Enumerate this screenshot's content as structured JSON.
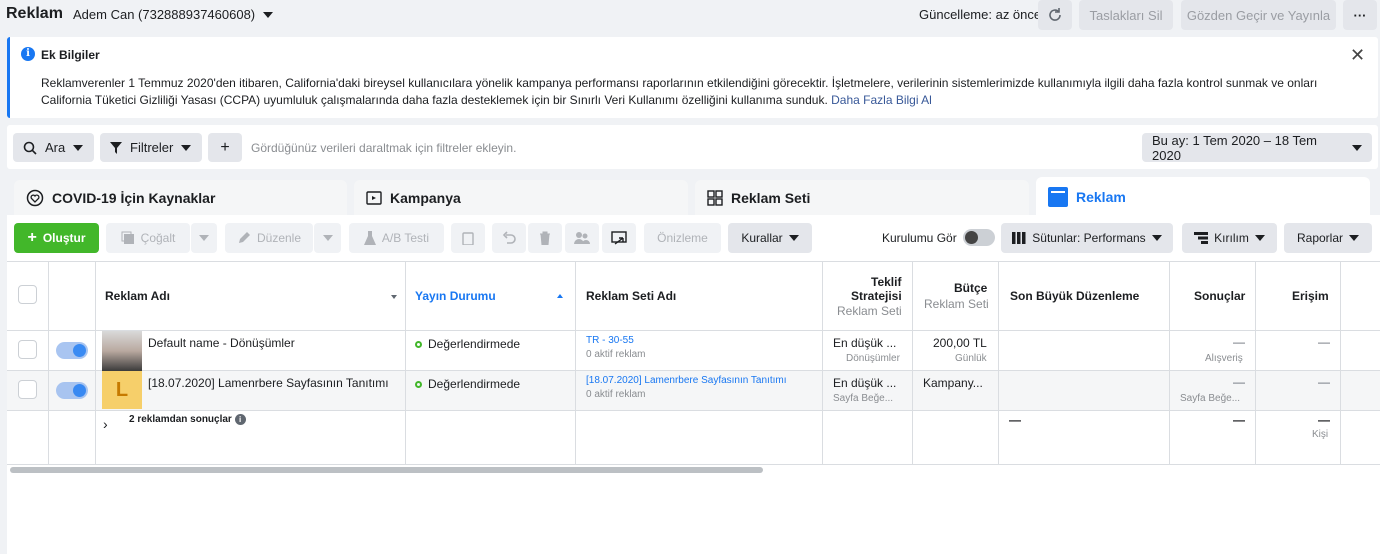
{
  "topbar": {
    "title": "Reklam",
    "account": "Adem Can (732888937460608)",
    "update_status": "Güncelleme: az önce",
    "delete_drafts": "Taslakları Sil",
    "review_publish": "Gözden Geçir ve Yayınla",
    "more": "···"
  },
  "banner": {
    "title": "Ek Bilgiler",
    "text": "Reklamverenler 1 Temmuz 2020'den itibaren, California'daki bireysel kullanıcılara yönelik kampanya performansı raporlarının etkilendiğini görecektir. İşletmelere, verilerinin sistemlerimizde kullanımıyla ilgili daha fazla kontrol sunmak ve onları California Tüketici Gizliliği Yasası (CCPA) uyumluluk çalışmalarında daha fazla desteklemek için bir Sınırlı Veri Kullanımı özelliğini kullanıma sunduk.",
    "link": "Daha Fazla Bilgi Al"
  },
  "filters": {
    "search": "Ara",
    "filters": "Filtreler",
    "add": "+",
    "hint": "Gördüğünüz verileri daraltmak için filtreler ekleyin.",
    "date_range": "Bu ay: 1 Tem 2020 – 18 Tem 2020"
  },
  "tabs": [
    {
      "label": "COVID-19 İçin Kaynaklar"
    },
    {
      "label": "Kampanya"
    },
    {
      "label": "Reklam Seti"
    },
    {
      "label": "Reklam"
    }
  ],
  "toolbar": {
    "create": "Oluştur",
    "duplicate": "Çoğalt",
    "edit": "Düzenle",
    "ab_test": "A/B Testi",
    "preview": "Önizleme",
    "rules": "Kurallar",
    "view_setup": "Kurulumu Gör",
    "columns": "Sütunlar: Performans",
    "breakdown": "Kırılım",
    "reports": "Raporlar"
  },
  "table": {
    "headers": {
      "ad_name": "Reklam Adı",
      "delivery": "Yayın Durumu",
      "adset_name": "Reklam Seti Adı",
      "bid_strategy_1": "Teklif",
      "bid_strategy_2": "Stratejisi",
      "bid_strategy_sub": "Reklam Seti",
      "budget": "Bütçe",
      "budget_sub": "Reklam Seti",
      "last_edit": "Son Büyük Düzenleme",
      "results": "Sonuçlar",
      "reach": "Erişim"
    },
    "rows": [
      {
        "name": "Default name - Dönüşümler",
        "delivery": "Değerlendirmede",
        "adset": "TR - 30-55",
        "adset_sub": "0 aktif reklam",
        "bid": "En düşük ...",
        "bid_sub": "Dönüşümler",
        "budget": "200,00 TL",
        "budget_sub": "Günlük",
        "results": "—",
        "results_sub": "Alışveriş",
        "reach": "—"
      },
      {
        "name": "[18.07.2020] Lamenrbere Sayfasının Tanıtımı",
        "delivery": "Değerlendirmede",
        "adset": "[18.07.2020] Lamenrbere Sayfasının Tanıtımı",
        "adset_sub": "0 aktif reklam",
        "bid": "En düşük ...",
        "bid_sub": "Sayfa Beğe...",
        "budget": "Kampany...",
        "results": "—",
        "results_sub": "Sayfa Beğe...",
        "reach": "—",
        "thumb_letter": "L"
      }
    ],
    "summary": {
      "label": "2 reklamdan sonuçlar",
      "last_edit": "—",
      "results": "—",
      "reach": "—",
      "reach_sub": "Kişi"
    }
  }
}
